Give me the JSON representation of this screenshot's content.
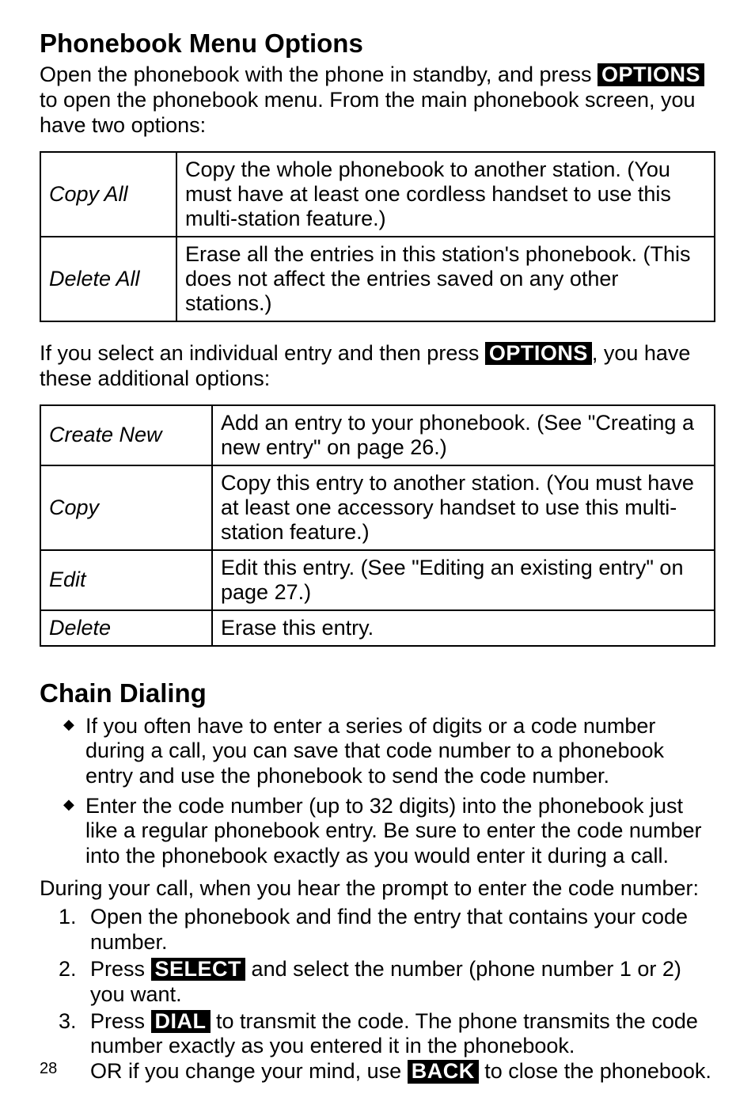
{
  "section1": {
    "title": "Phonebook Menu Options",
    "intro_before_pill": "Open the phonebook with the phone in standby, and press ",
    "intro_pill": "OPTIONS",
    "intro_after_pill": " to open the phonebook menu. From the main phonebook screen, you have two options:",
    "table1": [
      {
        "label": "Copy All",
        "desc": "Copy the whole phonebook to another station. (You must have at least one cordless handset to use this multi-station feature.)"
      },
      {
        "label": "Delete All",
        "desc": "Erase all the entries in this station's phonebook. (This does not affect the entries saved on any other stations.)"
      }
    ],
    "mid_before_pill": "If you select an individual entry and then press ",
    "mid_pill": "OPTIONS",
    "mid_after_pill": ", you have these additional options:",
    "table2": [
      {
        "label": "Create New",
        "desc": "Add an entry to your phonebook. (See \"Creating a new entry\" on page 26.)"
      },
      {
        "label": "Copy",
        "desc": "Copy this entry to another station. (You must have at least one accessory handset to use this multi-station feature.)"
      },
      {
        "label": "Edit",
        "desc": "Edit this entry. (See \"Editing an existing entry\" on page 27.)"
      },
      {
        "label": "Delete",
        "desc": "Erase this entry."
      }
    ]
  },
  "section2": {
    "title": "Chain Dialing",
    "bullets": [
      "If you often have to enter a series of digits or a code number during a call, you can save that code number to a phonebook entry and use the phonebook to send the code number.",
      "Enter the code number (up to 32 digits) into the phonebook just like a regular phonebook entry. Be sure to enter the code number into the phonebook exactly as you would enter it during a call."
    ],
    "prompt": "During your call, when you hear the prompt to enter the code number:",
    "steps": {
      "s1": "Open the phonebook and find the entry that contains your code number.",
      "s2_a": "Press ",
      "s2_pill": "SELECT",
      "s2_b": " and select the number (phone number 1 or 2) you want.",
      "s3_a": "Press ",
      "s3_pill1": "DIAL",
      "s3_b": " to transmit the code. The phone transmits the code number exactly as you entered it in the phonebook.",
      "s3_c": "OR if you change your mind, use ",
      "s3_pill2": "BACK",
      "s3_d": " to close the phonebook."
    }
  },
  "page_number": "28"
}
